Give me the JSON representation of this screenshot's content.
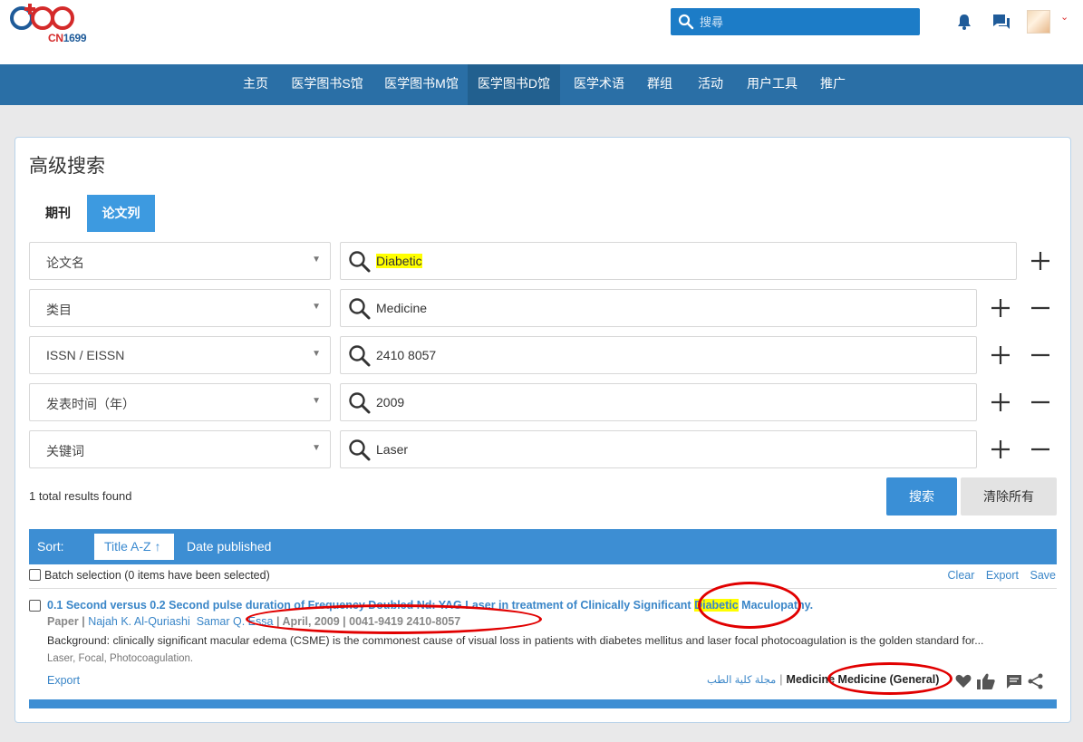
{
  "header": {
    "logo_text": "CN",
    "logo_number": "1699",
    "search_placeholder": "搜尋"
  },
  "nav": {
    "items": [
      {
        "label": "主页"
      },
      {
        "label": "医学图书S馆"
      },
      {
        "label": "医学图书M馆"
      },
      {
        "label": "医学图书D馆",
        "active": true
      },
      {
        "label": "医学术语"
      },
      {
        "label": "群组"
      },
      {
        "label": "活动"
      },
      {
        "label": "用户工具"
      },
      {
        "label": "推广"
      }
    ]
  },
  "search": {
    "title": "高级搜索",
    "tabs": {
      "journal": "期刊",
      "papers": "论文列"
    },
    "rows": [
      {
        "field": "论文名",
        "value": "Diabetic"
      },
      {
        "field": "类目",
        "value": "Medicine"
      },
      {
        "field": "ISSN / EISSN",
        "value": "2410 8057"
      },
      {
        "field": "发表时间（年）",
        "value": "2009"
      },
      {
        "field": "关键词",
        "value": "Laser"
      }
    ],
    "results_count": "1 total results found",
    "search_button": "搜索",
    "clear_button": "清除所有"
  },
  "sort": {
    "label": "Sort:",
    "active": "Title A-Z",
    "date": "Date published"
  },
  "batch": {
    "label": "Batch selection (0 items have been selected)",
    "clear": "Clear",
    "export": "Export",
    "save": "Save"
  },
  "result": {
    "title_prefix": "0.1 Second versus 0.2 Second pulse duration of Frequency Doubled Nd: YAG Laser in treatment of Clinically Significant ",
    "title_highlight": "Diabetic",
    "title_suffix": " Maculopathy.",
    "type": "Paper",
    "authors": [
      "Najah K. Al-Quriashi",
      "Samar Q. Essa"
    ],
    "date": "April, 2009",
    "issn": "0041-9419 2410-8057",
    "abstract": "Background: clinically significant macular edema (CSME) is the commonest cause of visual loss in patients with diabetes mellitus and laser focal photocoagulation is the golden standard for...",
    "keywords": "Laser, Focal, Photocoagulation.",
    "export": "Export",
    "journal_ar": "مجلة كلية الطب",
    "category": "Medicine",
    "subcategory": "Medicine (General)"
  },
  "colors": {
    "nav": "#2a6fa6",
    "accent": "#3d8ed3",
    "link": "#3a86c8",
    "highlight": "#ffff00",
    "annotation": "#e10000"
  }
}
